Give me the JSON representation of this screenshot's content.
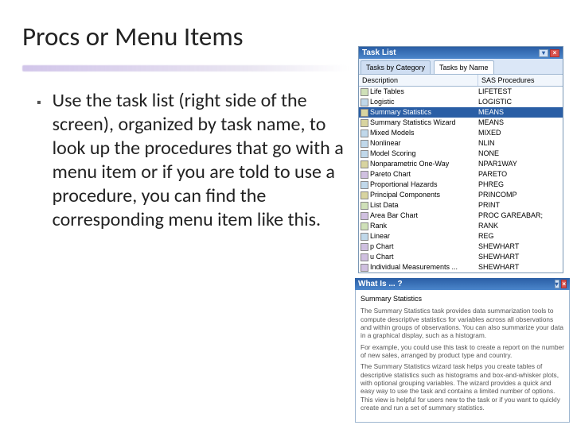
{
  "slide": {
    "title": "Procs or Menu Items",
    "bullet": "Use the task list (right side of the screen), organized by task name, to look up the procedures that go with a menu item or if you are told to use a procedure, you can find the corresponding menu item like this."
  },
  "taskList": {
    "title": "Task List",
    "tabs": {
      "byCategory": "Tasks by Category",
      "byName": "Tasks by Name"
    },
    "header": {
      "desc": "Description",
      "proc": "SAS Procedures"
    },
    "rows": [
      {
        "icon": "table",
        "desc": "Life Tables",
        "proc": "LIFETEST"
      },
      {
        "icon": "regr",
        "desc": "Logistic",
        "proc": "LOGISTIC"
      },
      {
        "icon": "stat",
        "desc": "Summary Statistics",
        "proc": "MEANS",
        "selected": true
      },
      {
        "icon": "stat",
        "desc": "Summary Statistics Wizard",
        "proc": "MEANS"
      },
      {
        "icon": "regr",
        "desc": "Mixed Models",
        "proc": "MIXED"
      },
      {
        "icon": "regr",
        "desc": "Nonlinear",
        "proc": "NLIN"
      },
      {
        "icon": "regr",
        "desc": "Model Scoring",
        "proc": "NONE"
      },
      {
        "icon": "stat",
        "desc": "Nonparametric One-Way",
        "proc": "NPAR1WAY"
      },
      {
        "icon": "chart",
        "desc": "Pareto Chart",
        "proc": "PARETO"
      },
      {
        "icon": "regr",
        "desc": "Proportional Hazards",
        "proc": "PHREG"
      },
      {
        "icon": "stat",
        "desc": "Principal Components",
        "proc": "PRINCOMP"
      },
      {
        "icon": "table",
        "desc": "List Data",
        "proc": "PRINT"
      },
      {
        "icon": "chart",
        "desc": "Area Bar Chart",
        "proc": "PROC GAREABAR;"
      },
      {
        "icon": "table",
        "desc": "Rank",
        "proc": "RANK"
      },
      {
        "icon": "regr",
        "desc": "Linear",
        "proc": "REG"
      },
      {
        "icon": "chart",
        "desc": "p Chart",
        "proc": "SHEWHART"
      },
      {
        "icon": "chart",
        "desc": "u Chart",
        "proc": "SHEWHART"
      },
      {
        "icon": "chart",
        "desc": "Individual Measurements ...",
        "proc": "SHEWHART"
      }
    ]
  },
  "whatIs": {
    "title": "What Is ... ?",
    "subject": "Summary Statistics",
    "p1": "The Summary Statistics task provides data summarization tools to compute descriptive statistics for variables across all observations and within groups of observations. You can also summarize your data in a graphical display, such as a histogram.",
    "p2": "For example, you could use this task to create a report on the number of new sales, arranged by product type and country.",
    "p3": "The Summary Statistics wizard task helps you create tables of descriptive statistics such as histograms and box-and-whisker plots, with optional grouping variables. The wizard provides a quick and easy way to use the task and contains a limited number of options. This view is helpful for users new to the task or if you want to quickly create and run a set of summary statistics."
  }
}
